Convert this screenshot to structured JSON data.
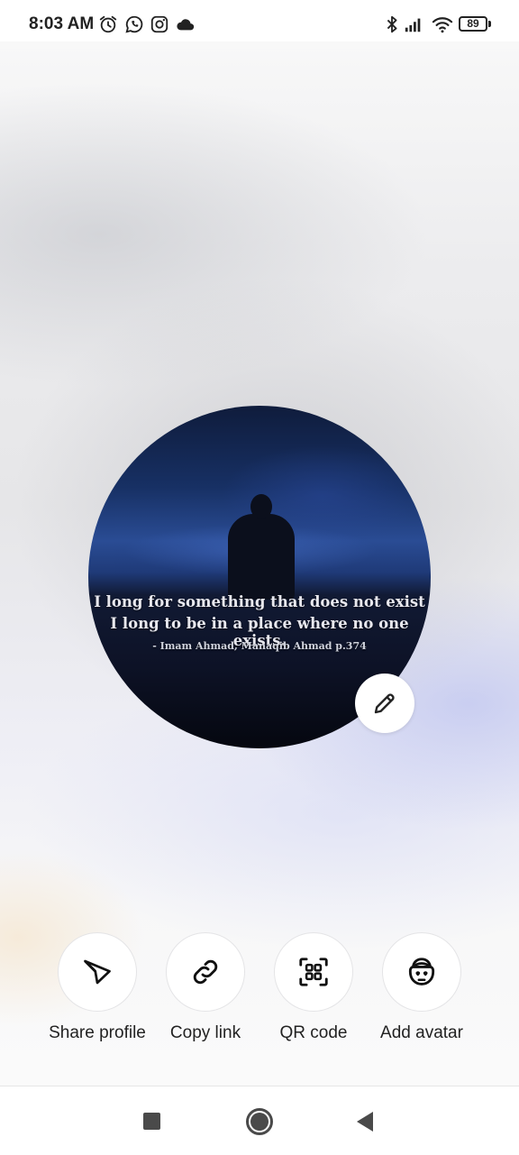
{
  "status_bar": {
    "time": "8:03 AM",
    "left_icons": [
      "alarm-icon",
      "whatsapp-icon",
      "instagram-icon",
      "cloud-icon"
    ],
    "right_icons": [
      "bluetooth-icon",
      "signal-icon",
      "wifi-icon"
    ],
    "battery": "89"
  },
  "avatar": {
    "quote_line_1": "I long for something that does not exist",
    "quote_line_2": "I long to be in a place where no one exists.",
    "quote_attribution": "- Imam Ahmad, Manaqib Ahmad p.374"
  },
  "actions": [
    {
      "label": "Share profile",
      "icon": "send-icon"
    },
    {
      "label": "Copy link",
      "icon": "link-icon"
    },
    {
      "label": "QR code",
      "icon": "qr-code-icon"
    },
    {
      "label": "Add avatar",
      "icon": "avatar-face-icon"
    }
  ],
  "nav_bar": {
    "buttons": [
      "recents-icon",
      "home-icon",
      "back-icon"
    ]
  }
}
